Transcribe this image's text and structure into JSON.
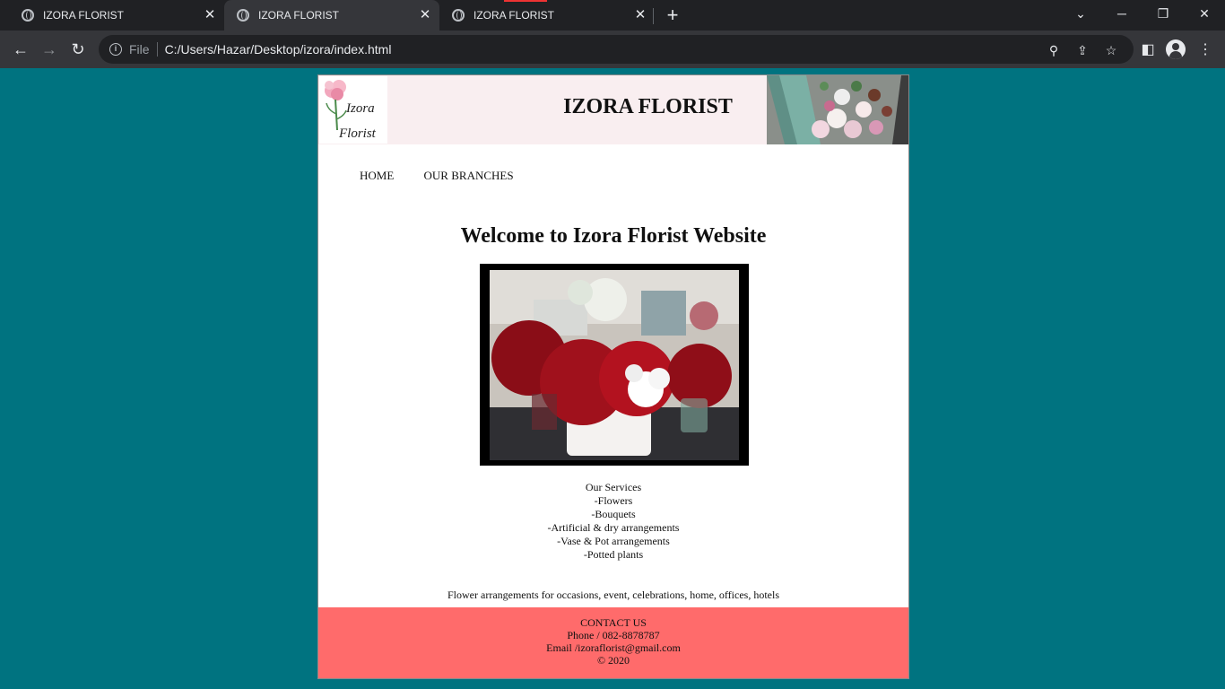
{
  "browser": {
    "tabs": [
      {
        "title": "IZORA FLORIST"
      },
      {
        "title": "IZORA FLORIST"
      },
      {
        "title": "IZORA FLORIST"
      }
    ],
    "active_tab": 1,
    "address": {
      "scheme_label": "File",
      "url": "C:/Users/Hazar/Desktop/izora/index.html"
    },
    "icons": [
      "back-icon",
      "forward-icon",
      "reload-icon",
      "info-icon",
      "zoom-icon",
      "share-icon",
      "star-icon",
      "side-panel-icon",
      "profile-icon",
      "menu-icon"
    ]
  },
  "site": {
    "logo_line1": "Izora",
    "logo_line2": "Florist",
    "title": "IZORA FLORIST",
    "nav": {
      "home": "HOME",
      "branches": "OUR BRANCHES"
    },
    "welcome": "Welcome to Izora Florist Website",
    "services": {
      "heading": "Our Services",
      "items": [
        "-Flowers",
        "-Bouquets",
        "-Artificial & dry arrangements",
        "-Vase & Pot arrangements",
        "-Potted plants"
      ]
    },
    "tagline": "Flower arrangements for occasions, event, celebrations, home, offices, hotels",
    "footer": {
      "heading": "CONTACT US",
      "phone": "Phone / 082-8878787",
      "email": "Email /izoraflorist@gmail.com",
      "copyright": "© 2020"
    }
  },
  "colors": {
    "background": "#007380",
    "banner": "#f9eef0",
    "footer": "#ff6b6b",
    "chrome_dark": "#202124",
    "chrome_toolbar": "#35363a"
  }
}
